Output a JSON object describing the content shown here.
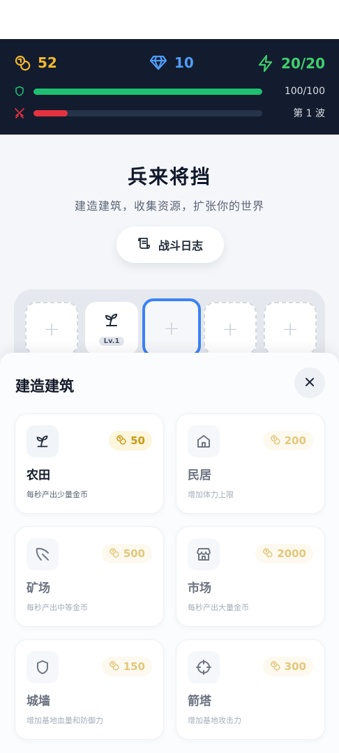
{
  "resources": {
    "gold": "52",
    "gems": "10",
    "energy": "20/20"
  },
  "bars": {
    "hp_text": "100/100",
    "hp_fraction": 1.0,
    "wave_text": "第 1 波",
    "wave_fraction": 0.15
  },
  "header": {
    "title": "兵来将挡",
    "subtitle": "建造建筑，收集资源，扩张你的世界",
    "log_button": "战斗日志"
  },
  "slots": [
    {
      "state": "empty",
      "label": "+"
    },
    {
      "state": "filled",
      "building": "farm",
      "level": "Lv.1"
    },
    {
      "state": "selected",
      "label": "+"
    },
    {
      "state": "empty",
      "label": "+"
    },
    {
      "state": "empty",
      "label": "+"
    }
  ],
  "sheet": {
    "title": "建造建筑",
    "close_icon": "close-icon"
  },
  "buildings": [
    {
      "name": "农田",
      "desc": "每秒产出少量金币",
      "cost": "50",
      "icon": "sprout-icon",
      "affordable": true
    },
    {
      "name": "民居",
      "desc": "增加体力上限",
      "cost": "200",
      "icon": "house-icon",
      "affordable": false
    },
    {
      "name": "矿场",
      "desc": "每秒产出中等金币",
      "cost": "500",
      "icon": "pickaxe-icon",
      "affordable": false
    },
    {
      "name": "市场",
      "desc": "每秒产出大量金币",
      "cost": "2000",
      "icon": "store-icon",
      "affordable": false
    },
    {
      "name": "城墙",
      "desc": "增加基地血量和防御力",
      "cost": "150",
      "icon": "shield-icon",
      "affordable": false
    },
    {
      "name": "箭塔",
      "desc": "增加基地攻击力",
      "cost": "300",
      "icon": "crosshair-icon",
      "affordable": false
    }
  ],
  "colors": {
    "header_bg": "#131c2e",
    "gold": "#f5b82e",
    "gem": "#4f9cf9",
    "energy": "#3ecf6e",
    "hp": "#1fbf72",
    "wave": "#e5323f",
    "selected": "#3b82f6"
  }
}
